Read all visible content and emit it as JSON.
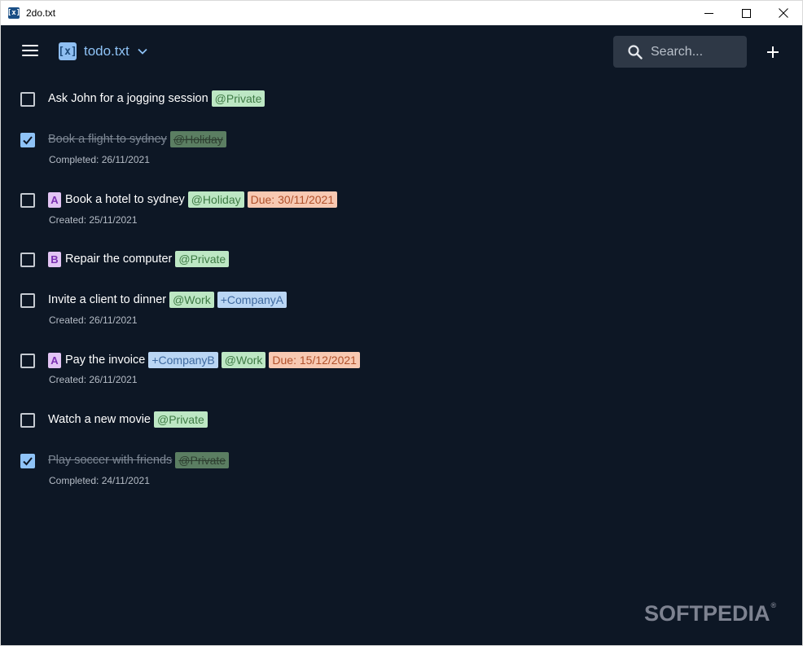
{
  "window": {
    "title": "2do.txt",
    "app_icon": "2do-app-icon"
  },
  "toolbar": {
    "list_name": "todo.txt",
    "search_placeholder": "Search..."
  },
  "colors": {
    "background": "#0d1725",
    "accent": "#8ec2f5",
    "context_tag": "#bde7c4",
    "project_tag": "#bad6f4",
    "due_tag": "#f8c9b2",
    "priority": "#e2c4f4"
  },
  "tasks": [
    {
      "text": "Ask John for a jogging session",
      "done": false,
      "tags": [
        "@Private"
      ]
    },
    {
      "text": "Book a flight to sydney",
      "done": true,
      "tags": [
        "@Holiday"
      ],
      "subtext": "Completed: 26/11/2021"
    },
    {
      "priority": "A",
      "text": "Book a hotel to sydney",
      "done": false,
      "tags": [
        "@Holiday",
        "Due: 30/11/2021"
      ],
      "subtext": "Created: 25/11/2021"
    },
    {
      "priority": "B",
      "text": "Repair the computer",
      "done": false,
      "tags": [
        "@Private"
      ]
    },
    {
      "text": "Invite a client to dinner",
      "done": false,
      "tags": [
        "@Work",
        "+CompanyA"
      ],
      "subtext": "Created: 26/11/2021"
    },
    {
      "priority": "A",
      "text": "Pay the invoice",
      "done": false,
      "tags": [
        "+CompanyB",
        "@Work",
        "Due: 15/12/2021"
      ],
      "subtext": "Created: 26/11/2021"
    },
    {
      "text": "Watch a new movie",
      "done": false,
      "tags": [
        "@Private"
      ]
    },
    {
      "text": "Play soccer with friends",
      "done": true,
      "tags": [
        "@Private"
      ],
      "subtext": "Completed: 24/11/2021"
    }
  ],
  "watermark": "SOFTPEDIA",
  "watermark_mark": "®"
}
